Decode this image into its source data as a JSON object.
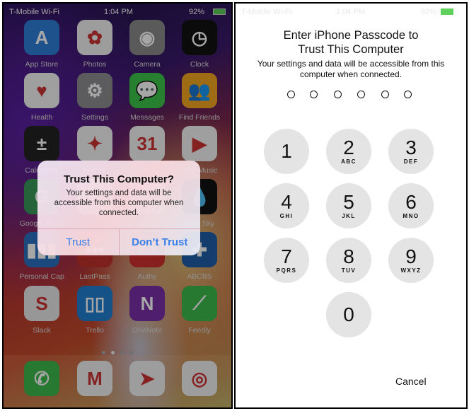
{
  "left": {
    "status": {
      "carrier": "T-Mobile Wi-Fi",
      "time": "1:04 PM",
      "battery": "92%"
    },
    "apps": [
      {
        "label": "App Store",
        "icon": "app-store-icon",
        "color": "#2f7fd8",
        "glyph": "A"
      },
      {
        "label": "Photos",
        "icon": "photos-icon",
        "color": "#f2f2f2",
        "glyph": "✿"
      },
      {
        "label": "Camera",
        "icon": "camera-icon",
        "color": "#8a8a8a",
        "glyph": "◉"
      },
      {
        "label": "Clock",
        "icon": "clock-icon",
        "color": "#111",
        "glyph": "◷"
      },
      {
        "label": "Health",
        "icon": "health-icon",
        "color": "#f4f4f4",
        "glyph": "♥"
      },
      {
        "label": "Settings",
        "icon": "settings-icon",
        "color": "#8e8e93",
        "glyph": "⚙"
      },
      {
        "label": "Messages",
        "icon": "messages-icon",
        "color": "#3cc44a",
        "glyph": "💬"
      },
      {
        "label": "Find Friends",
        "icon": "find-friends-icon",
        "color": "#f5a623",
        "glyph": "👥"
      },
      {
        "label": "Calculator",
        "icon": "calculator-icon",
        "color": "#222",
        "glyph": "±"
      },
      {
        "label": "Photos",
        "icon": "google-photos-icon",
        "color": "#f4f4f4",
        "glyph": "✦"
      },
      {
        "label": "Calendar",
        "icon": "calendar-icon",
        "color": "#f4f4f4",
        "glyph": "31"
      },
      {
        "label": "Play Music",
        "icon": "play-music-icon",
        "color": "#f4f4f4",
        "glyph": "▶"
      },
      {
        "label": "Google Maps",
        "icon": "maps-icon",
        "color": "#3a9a5a",
        "glyph": "G"
      },
      {
        "label": "",
        "icon": "app-icon",
        "color": "#ddd",
        "glyph": ""
      },
      {
        "label": "",
        "icon": "app-icon",
        "color": "#ddd",
        "glyph": ""
      },
      {
        "label": "Dark Sky",
        "icon": "dark-sky-icon",
        "color": "#111",
        "glyph": "💧"
      },
      {
        "label": "Personal Cap",
        "icon": "personal-capital-icon",
        "color": "#2a6fc0",
        "glyph": "▮▮▮"
      },
      {
        "label": "LastPass",
        "icon": "lastpass-icon",
        "color": "#c0302a",
        "glyph": "•••"
      },
      {
        "label": "Authy",
        "icon": "authy-icon",
        "color": "#d03030",
        "glyph": "◠"
      },
      {
        "label": "ABCBS",
        "icon": "abcbs-icon",
        "color": "#1f5fa8",
        "glyph": "✚"
      },
      {
        "label": "Slack",
        "icon": "slack-icon",
        "color": "#e8e8e8",
        "glyph": "S"
      },
      {
        "label": "Trello",
        "icon": "trello-icon",
        "color": "#1f7fd0",
        "glyph": "▯▯"
      },
      {
        "label": "OneNote",
        "icon": "onenote-icon",
        "color": "#7a2fa8",
        "glyph": "N"
      },
      {
        "label": "Feedly",
        "icon": "feedly-icon",
        "color": "#3cb84a",
        "glyph": "⟋"
      }
    ],
    "dock": [
      {
        "icon": "phone-icon",
        "color": "#3cb84a",
        "glyph": "✆"
      },
      {
        "icon": "gmail-icon",
        "color": "#f2f2f2",
        "glyph": "M"
      },
      {
        "icon": "telegram-icon",
        "color": "#f2f2f2",
        "glyph": "➤"
      },
      {
        "icon": "chrome-icon",
        "color": "#f2f2f2",
        "glyph": "◎"
      }
    ],
    "alert": {
      "title": "Trust This Computer?",
      "message": "Your settings and data will be accessible from this computer when connected.",
      "trust": "Trust",
      "dont_trust": "Don’t Trust"
    }
  },
  "right": {
    "status": {
      "carrier": "T-Mobile Wi-Fi",
      "time": "1:04 PM",
      "battery": "92%"
    },
    "title": "Enter iPhone Passcode to Trust This Computer",
    "subtitle": "Your settings and data will be accessible from this computer when connected.",
    "keys": [
      {
        "digit": "1",
        "letters": ""
      },
      {
        "digit": "2",
        "letters": "ABC"
      },
      {
        "digit": "3",
        "letters": "DEF"
      },
      {
        "digit": "4",
        "letters": "GHI"
      },
      {
        "digit": "5",
        "letters": "JKL"
      },
      {
        "digit": "6",
        "letters": "MNO"
      },
      {
        "digit": "7",
        "letters": "PQRS"
      },
      {
        "digit": "8",
        "letters": "TUV"
      },
      {
        "digit": "9",
        "letters": "WXYZ"
      },
      {
        "digit": "0",
        "letters": ""
      }
    ],
    "cancel": "Cancel"
  }
}
